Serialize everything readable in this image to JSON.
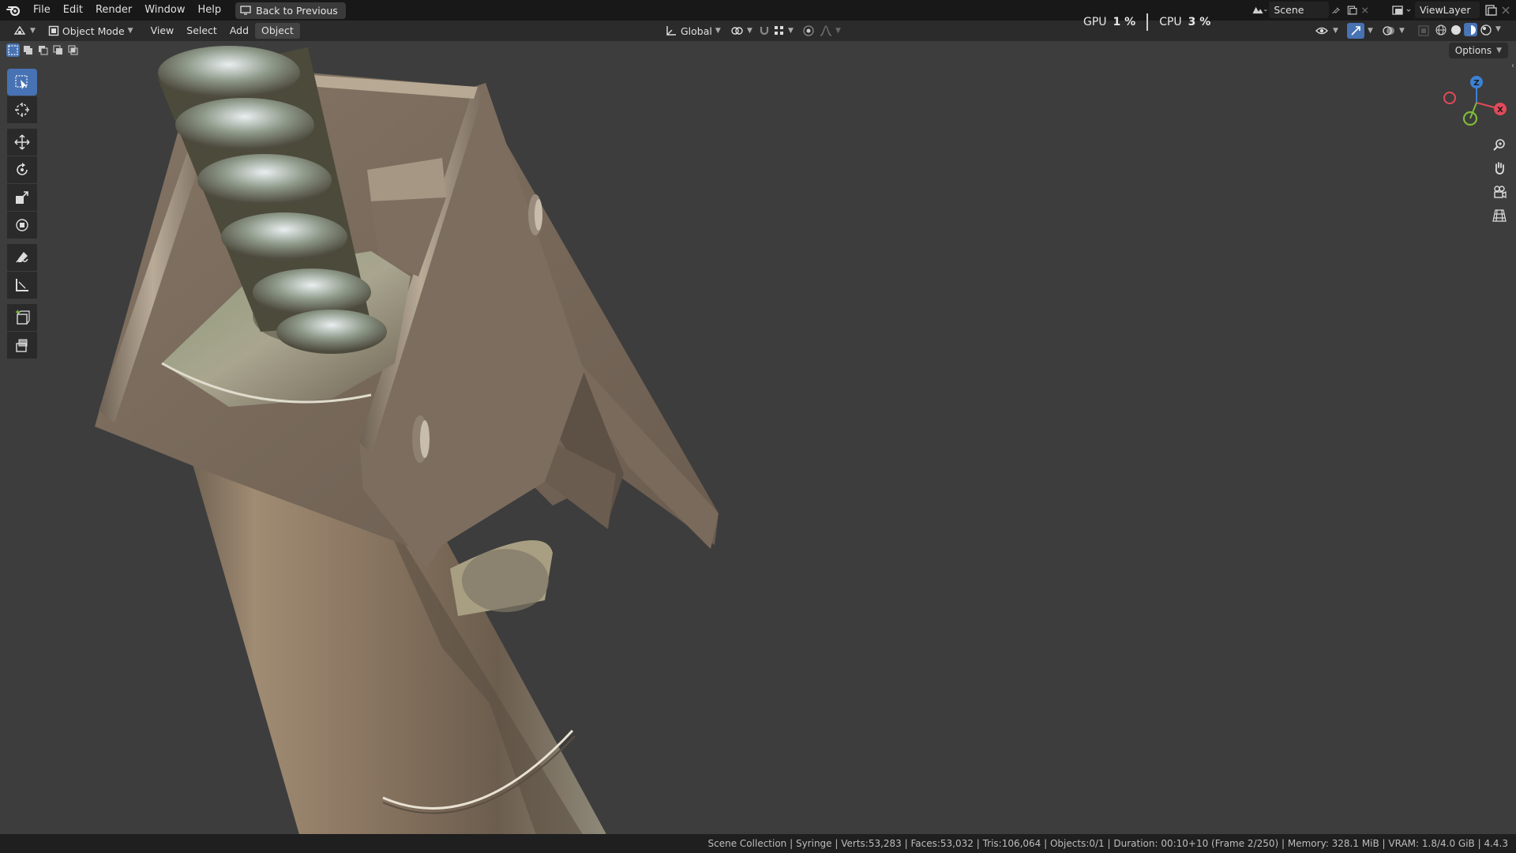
{
  "menubar": {
    "items": [
      "File",
      "Edit",
      "Render",
      "Window",
      "Help"
    ],
    "back_button": "Back to Previous"
  },
  "stats": {
    "gpu_label": "GPU",
    "gpu_value": "1 %",
    "cpu_label": "CPU",
    "cpu_value": "3 %"
  },
  "scene": {
    "name": "Scene"
  },
  "viewlayer": {
    "name": "ViewLayer"
  },
  "header": {
    "mode": "Object Mode",
    "menus": [
      "View",
      "Select",
      "Add",
      "Object"
    ],
    "transform_orientation": "Global"
  },
  "viewport": {
    "options_label": "Options",
    "gizmo": {
      "z": "Z",
      "x": "X"
    }
  },
  "statusbar": {
    "text": "Scene Collection | Syringe | Verts:53,283 | Faces:53,032 | Tris:106,064 | Objects:0/1 | Duration: 00:10+10 (Frame 2/250) | Memory: 328.1 MiB | VRAM: 1.8/4.0 GiB | 4.4.3"
  },
  "colors": {
    "accent": "#4772b3",
    "viewport_bg": "#3d3d3d",
    "axis_x": "#e24a5a",
    "axis_y": "#7fbb3a",
    "axis_z": "#3b82d6"
  }
}
